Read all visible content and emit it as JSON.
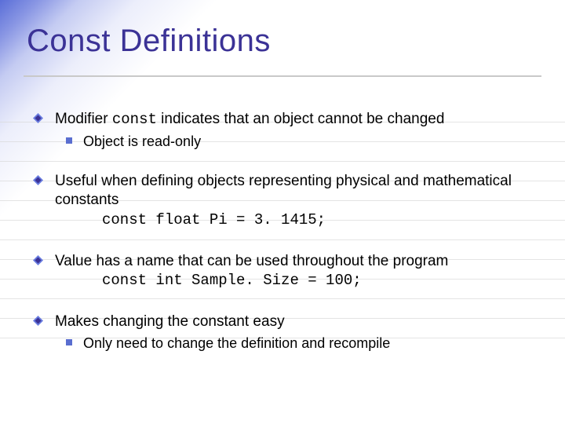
{
  "title": "Const Definitions",
  "bullets": {
    "b1": {
      "pre": "Modifier ",
      "kw": "const",
      "post": " indicates that an object cannot be changed",
      "sub": "Object is read-only"
    },
    "b2": {
      "text": "Useful when defining objects representing physical and mathematical constants",
      "code": "const float Pi = 3. 1415;"
    },
    "b3": {
      "text": "Value has a name that can be used throughout the program",
      "code": "const int Sample. Size = 100;"
    },
    "b4": {
      "text": "Makes changing the constant easy",
      "sub": "Only need to change the definition and recompile"
    }
  }
}
